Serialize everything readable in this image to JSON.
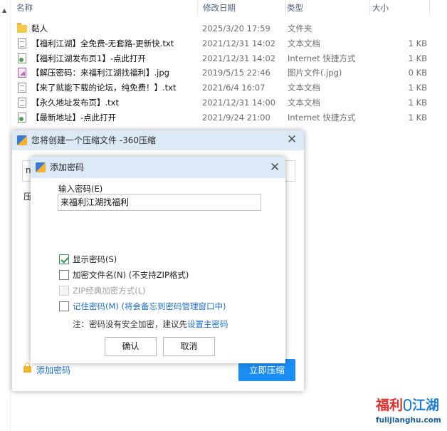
{
  "explorer": {
    "columns": {
      "name": "名称",
      "date": "修改日期",
      "type": "类型",
      "size": "大小"
    },
    "rows": [
      {
        "icon": "folder-icon",
        "name": "黏人",
        "date": "2025/3/20 17:59",
        "type": "文件夹",
        "size": ""
      },
      {
        "icon": "text-file-icon",
        "name": "【福利江湖】全免费-无套路-更新快.txt",
        "date": "2021/12/31 14:02",
        "type": "文本文档",
        "size": "1 KB"
      },
      {
        "icon": "shortcut-icon",
        "name": "【福利江湖发布页1】-点此打开",
        "date": "2021/12/31 14:02",
        "type": "Internet 快捷方式",
        "size": "1 KB"
      },
      {
        "icon": "image-file-icon",
        "name": "【解压密码：来福利江湖找福利】.jpg",
        "date": "2019/5/15 22:46",
        "type": "图片文件(.jpg)",
        "size": "0 KB"
      },
      {
        "icon": "text-file-icon",
        "name": "【来了就能下载的论坛，纯免费！】.txt",
        "date": "2021/6/4 16:07",
        "type": "文本文档",
        "size": "1 KB"
      },
      {
        "icon": "text-file-icon",
        "name": "【永久地址发布页】.txt",
        "date": "2021/12/31 14:00",
        "type": "文本文档",
        "size": "1 KB"
      },
      {
        "icon": "shortcut-icon",
        "name": "【最新地址】-点此打开",
        "date": "2021/9/24 21:00",
        "type": "Internet 快捷方式",
        "size": "1 KB"
      }
    ]
  },
  "compress_window": {
    "title": "您将创建一个压缩文件 -360压缩",
    "input_prefix": "n",
    "side_label": "压",
    "add_password": "添加密码",
    "primary_button": "立即压缩"
  },
  "password_dialog": {
    "title": "添加密码",
    "field_label": "输入密码(E)",
    "password_value": "来福利江湖找福利",
    "options": {
      "show_password": "显示密码(S)",
      "encrypt_filenames": "加密文件名(N) (不支持ZIP格式)",
      "zip_classic": "ZIP经典加密方式(L)",
      "remember_password": "记住密码(M) (将会备忘到密码管理窗口中)"
    },
    "note_prefix": "注：密码没有安全加密，建议先",
    "note_link": "设置主密码",
    "ok_button": "确认",
    "cancel_button": "取消"
  },
  "watermark": {
    "chars_red": "福利",
    "chars_blue": "江湖",
    "domain": "fulijianghu.com"
  }
}
